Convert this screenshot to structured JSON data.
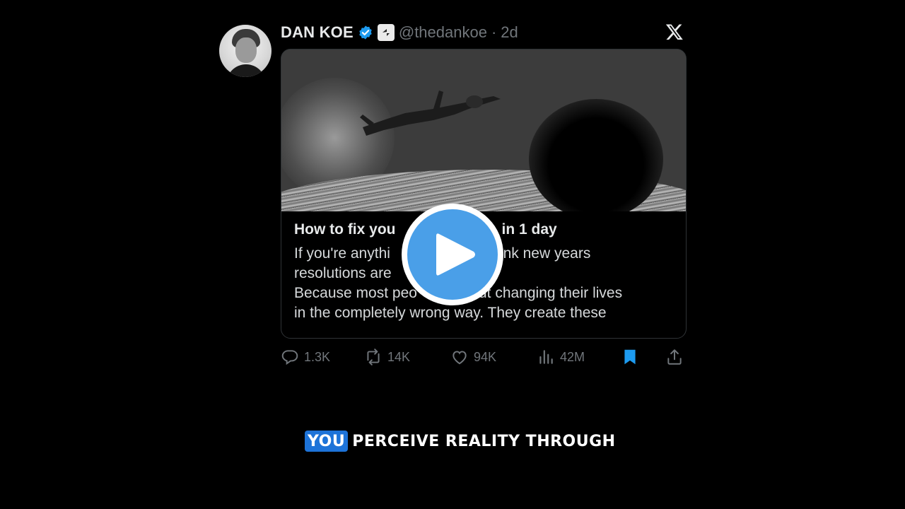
{
  "author": {
    "display_name": "DAN KOE",
    "handle": "@thedankoe",
    "separator": "·",
    "age": "2d"
  },
  "article": {
    "title": "How to fix you",
    "title_end": "in 1 day",
    "body_line1_start": "If you're anythi",
    "body_line1_end": "u think new years",
    "body_line2": "resolutions are",
    "body_line3_start": "Because most peo",
    "body_line3_end": "about changing their lives",
    "body_line4": "in the completely wrong way. They create these"
  },
  "stats": {
    "replies": "1.3K",
    "reposts": "14K",
    "likes": "94K",
    "views": "42M"
  },
  "caption": {
    "highlight": "YOU",
    "rest": "PERCEIVE REALITY THROUGH"
  },
  "colors": {
    "background": "#000000",
    "accent_blue": "#1d9bf0",
    "play_blue": "#4a9fe8",
    "caption_highlight": "#1d73d8",
    "muted": "#71767b"
  },
  "icons": [
    "verified-icon",
    "affiliate-badge-icon",
    "x-logo-icon",
    "play-icon",
    "reply-icon",
    "repost-icon",
    "like-icon",
    "views-icon",
    "bookmark-icon",
    "share-icon"
  ]
}
